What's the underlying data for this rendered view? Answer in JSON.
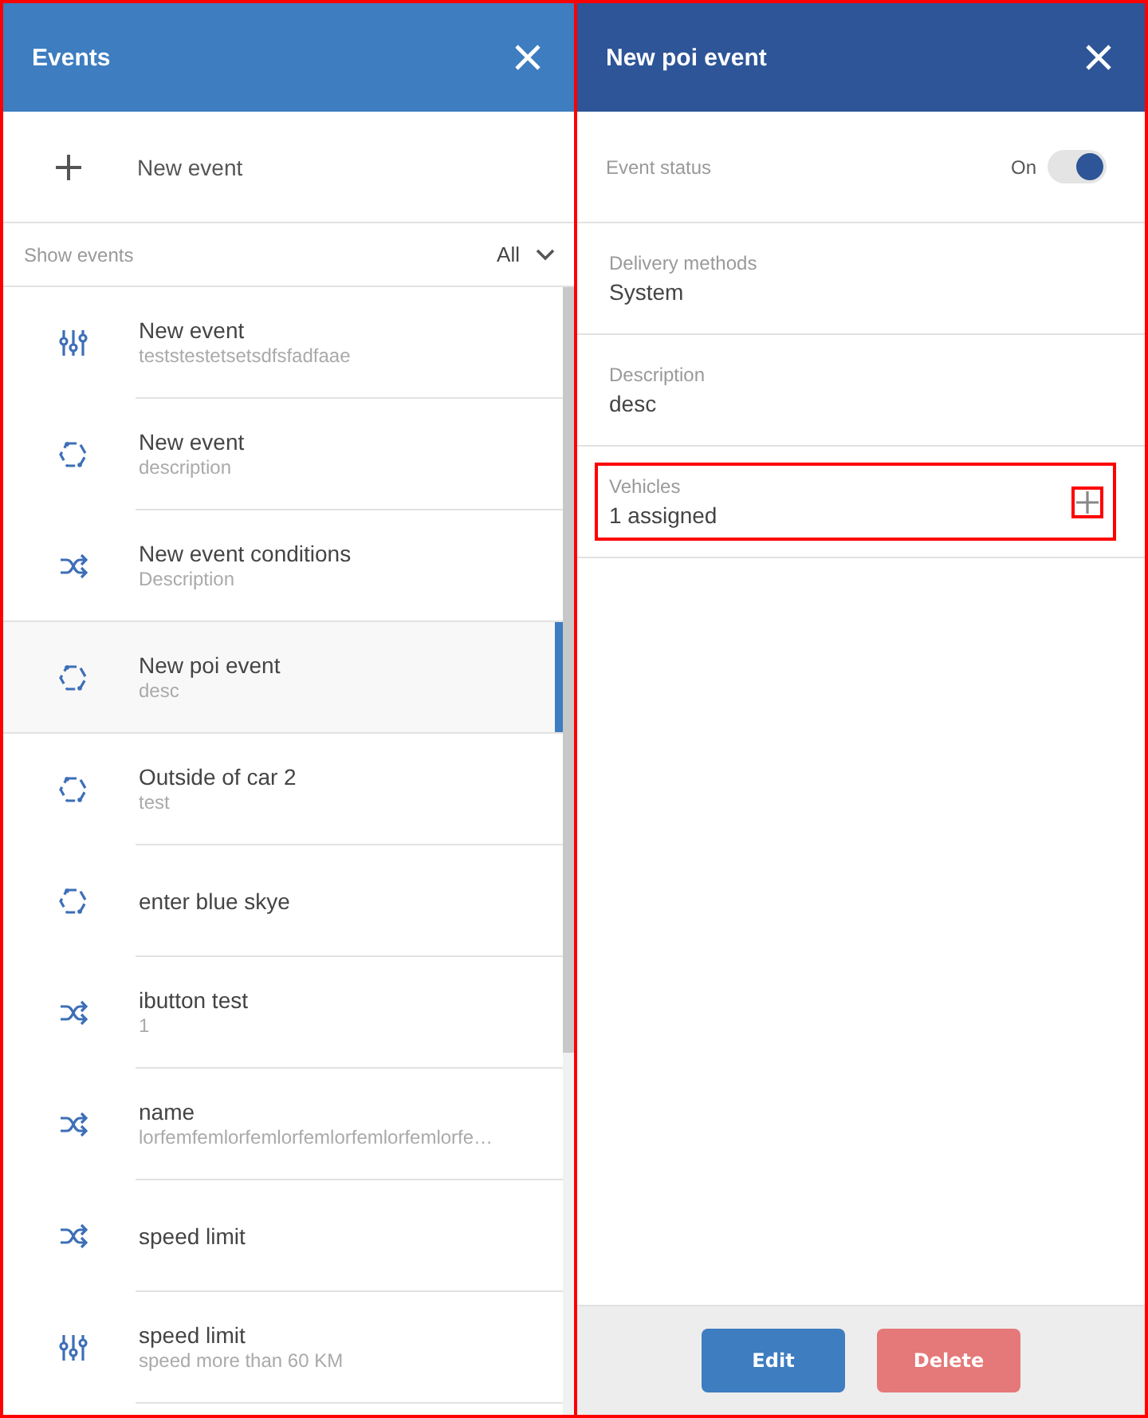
{
  "events_panel": {
    "title": "Events",
    "new_event_label": "New event",
    "filter": {
      "label": "Show events",
      "value": "All"
    },
    "events": [
      {
        "kind": "sliders",
        "title": "New event",
        "subtitle": "teststestetsetsdfsfadfaae",
        "selected": false
      },
      {
        "kind": "polygon",
        "title": "New event",
        "subtitle": "description",
        "selected": false
      },
      {
        "kind": "shuffle",
        "title": "New event conditions",
        "subtitle": "Description",
        "selected": false
      },
      {
        "kind": "polygon",
        "title": "New poi event",
        "subtitle": "desc",
        "selected": true
      },
      {
        "kind": "polygon",
        "title": "Outside of car 2",
        "subtitle": "test",
        "selected": false
      },
      {
        "kind": "polygon",
        "title": "enter blue skye",
        "selected": false
      },
      {
        "kind": "shuffle",
        "title": "ibutton test",
        "subtitle": "1",
        "selected": false
      },
      {
        "kind": "shuffle",
        "title": "name",
        "subtitle": "lorfemfemlorfemlorfemlorfemlorfemlorfe…",
        "selected": false
      },
      {
        "kind": "shuffle",
        "title": "speed limit",
        "selected": false
      },
      {
        "kind": "sliders",
        "title": "speed limit",
        "subtitle": "speed more than 60 KM",
        "selected": false
      }
    ]
  },
  "detail_panel": {
    "title": "New poi event",
    "status": {
      "label": "Event status",
      "state_text": "On",
      "on": true
    },
    "fields": [
      {
        "kind": "text",
        "label": "Delivery methods",
        "value": "System"
      },
      {
        "kind": "text",
        "label": "Description",
        "value": "desc"
      },
      {
        "kind": "assign",
        "label": "Vehicles",
        "value": "1 assigned"
      }
    ],
    "buttons": [
      {
        "kind": "primary",
        "label": "Edit"
      },
      {
        "kind": "danger",
        "label": "Delete"
      }
    ]
  }
}
